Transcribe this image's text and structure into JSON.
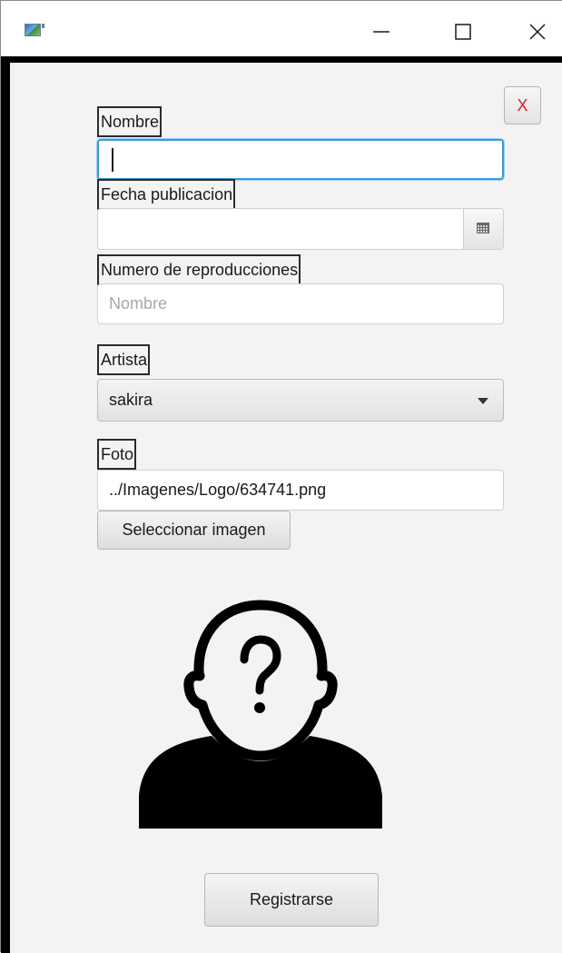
{
  "window": {
    "title": "",
    "icons": [
      "app-icon",
      "minimize-icon",
      "maximize-icon",
      "close-icon"
    ]
  },
  "form": {
    "close_button": "X",
    "nombre": {
      "label": "Nombre",
      "value": ""
    },
    "fecha": {
      "label": "Fecha publicacion",
      "value": "",
      "picker_icon": "calendar-icon"
    },
    "reproducciones": {
      "label": "Numero de reproducciones",
      "placeholder": "Nombre",
      "value": ""
    },
    "artista": {
      "label": "Artista",
      "selected": "sakira"
    },
    "foto": {
      "label": "Foto",
      "path": "../Imagenes/Logo/634741.png",
      "select_button": "Seleccionar imagen",
      "preview_icon": "unknown-person-icon"
    },
    "register_button": "Registrarse"
  },
  "colors": {
    "background": "#f3f3f3",
    "focus_border": "#3d9ad6",
    "close_x": "#e02020",
    "frame": "#000000"
  }
}
